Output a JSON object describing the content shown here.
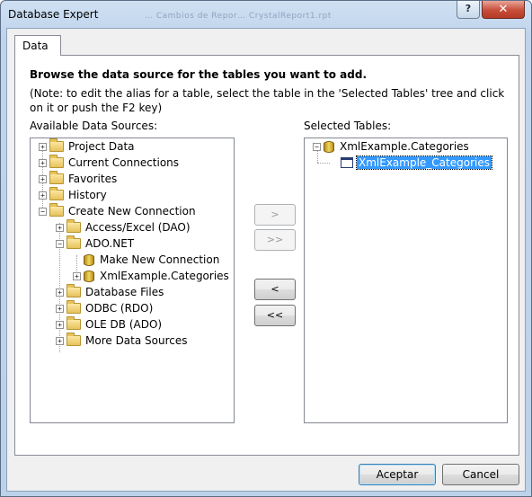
{
  "window": {
    "title": "Database Expert",
    "background_title": "…  Cambios de Repor…  CrystalReport1.rpt",
    "help_label": "?",
    "close_label": "✕"
  },
  "tabs": [
    {
      "label": "Data"
    }
  ],
  "instructions": {
    "heading": "Browse the data source for the tables you want to add.",
    "note": "(Note: to edit the alias for a table, select the table in the 'Selected Tables' tree and click on it or push the F2 key)"
  },
  "available": {
    "label": "Available Data Sources:",
    "nodes": [
      {
        "label": "Project Data",
        "expander": "+",
        "icon": "folder-icon"
      },
      {
        "label": "Current Connections",
        "expander": "+",
        "icon": "folder-icon"
      },
      {
        "label": "Favorites",
        "expander": "+",
        "icon": "folder-icon"
      },
      {
        "label": "History",
        "expander": "+",
        "icon": "folder-icon"
      },
      {
        "label": "Create New Connection",
        "expander": "−",
        "icon": "folder-icon"
      },
      {
        "label": "Access/Excel (DAO)",
        "expander": "+",
        "icon": "folder-icon"
      },
      {
        "label": "ADO.NET",
        "expander": "−",
        "icon": "folder-icon"
      },
      {
        "label": "Make New Connection",
        "expander": "",
        "icon": "database-icon"
      },
      {
        "label": "XmlExample.Categories",
        "expander": "+",
        "icon": "database-icon"
      },
      {
        "label": "Database Files",
        "expander": "+",
        "icon": "folder-icon"
      },
      {
        "label": "ODBC (RDO)",
        "expander": "+",
        "icon": "folder-icon"
      },
      {
        "label": "OLE DB (ADO)",
        "expander": "+",
        "icon": "folder-icon"
      },
      {
        "label": "More Data Sources",
        "expander": "+",
        "icon": "folder-icon"
      }
    ]
  },
  "selected": {
    "label": "Selected Tables:",
    "nodes": [
      {
        "label": "XmlExample.Categories",
        "expander": "−",
        "icon": "database-icon"
      },
      {
        "label": "XmlExample_Categories",
        "expander": "",
        "icon": "table-icon",
        "selected": true
      }
    ]
  },
  "move_buttons": {
    "add_one": ">",
    "add_all": ">>",
    "remove_one": "<",
    "remove_all": "<<"
  },
  "footer": {
    "ok_label": "Aceptar",
    "cancel_label": "Cancel"
  },
  "colors": {
    "selection": "#3399ff",
    "close_button": "#c74e3a",
    "frame": "#bcd2ea"
  }
}
